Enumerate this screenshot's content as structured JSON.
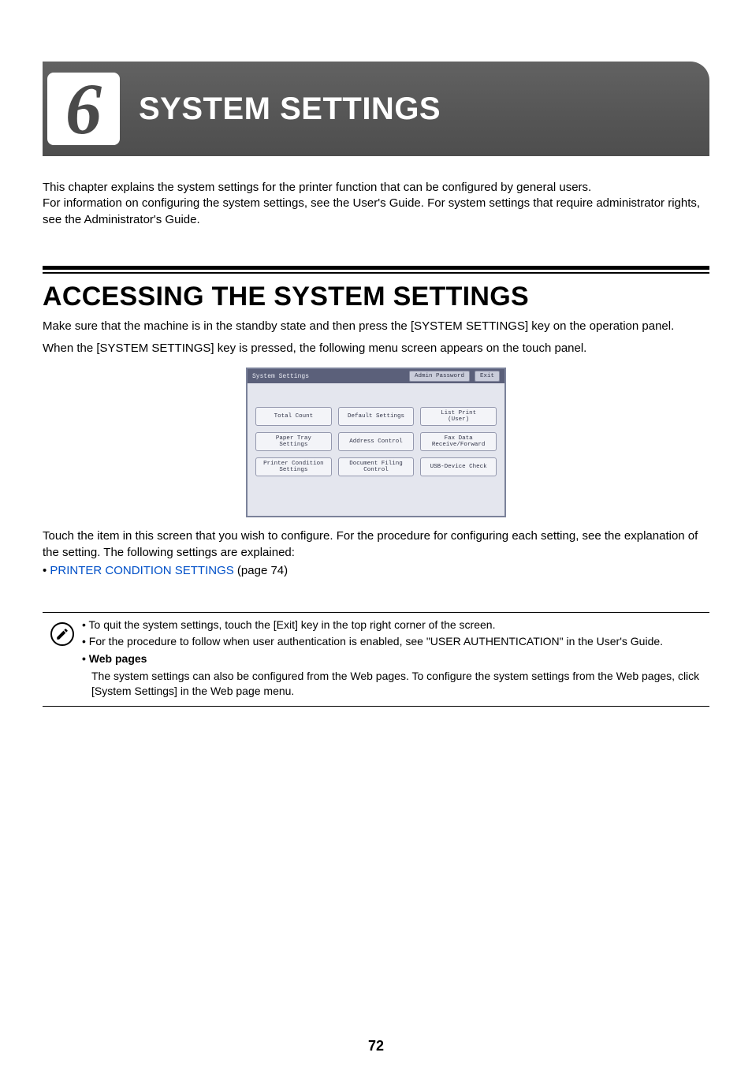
{
  "chapter": {
    "number": "6",
    "title": "SYSTEM SETTINGS"
  },
  "intro": {
    "p1": "This chapter explains the system settings for the printer function that can be configured by general users.",
    "p2": "For information on configuring the system settings, see the User's Guide. For system settings that require administrator rights, see the Administrator's Guide."
  },
  "section": {
    "title": "ACCESSING THE SYSTEM SETTINGS",
    "p1": "Make sure that the machine is in the standby state and then press the [SYSTEM SETTINGS] key on the operation panel.",
    "p2": "When the [SYSTEM SETTINGS] key is pressed, the following menu screen appears on the touch panel."
  },
  "panel": {
    "header_title": "System Settings",
    "admin_btn": "Admin Password",
    "exit_btn": "Exit",
    "buttons": [
      "Total Count",
      "Default Settings",
      "List Print\n(User)",
      "Paper Tray\nSettings",
      "Address Control",
      "Fax Data\nReceive/Forward",
      "Printer Condition\nSettings",
      "Document Filing\nControl",
      "USB-Device Check"
    ]
  },
  "after_panel": {
    "p1": "Touch the item in this screen that you wish to configure. For the procedure for configuring each setting, see the explanation of the setting. The following settings are explained:",
    "bullet_prefix": " • ",
    "link_text": "PRINTER CONDITION SETTINGS",
    "link_suffix": " (page 74)"
  },
  "note": {
    "b1": "• To quit the system settings, touch the [Exit] key in the top right corner of the screen.",
    "b2": "• For the procedure to follow when user authentication is enabled, see \"USER AUTHENTICATION\" in the User's Guide.",
    "b3_label": "• Web pages",
    "b3_body": "The system settings can also be configured from the Web pages. To configure the system settings from the Web pages, click [System Settings] in the Web page menu."
  },
  "page_number": "72"
}
